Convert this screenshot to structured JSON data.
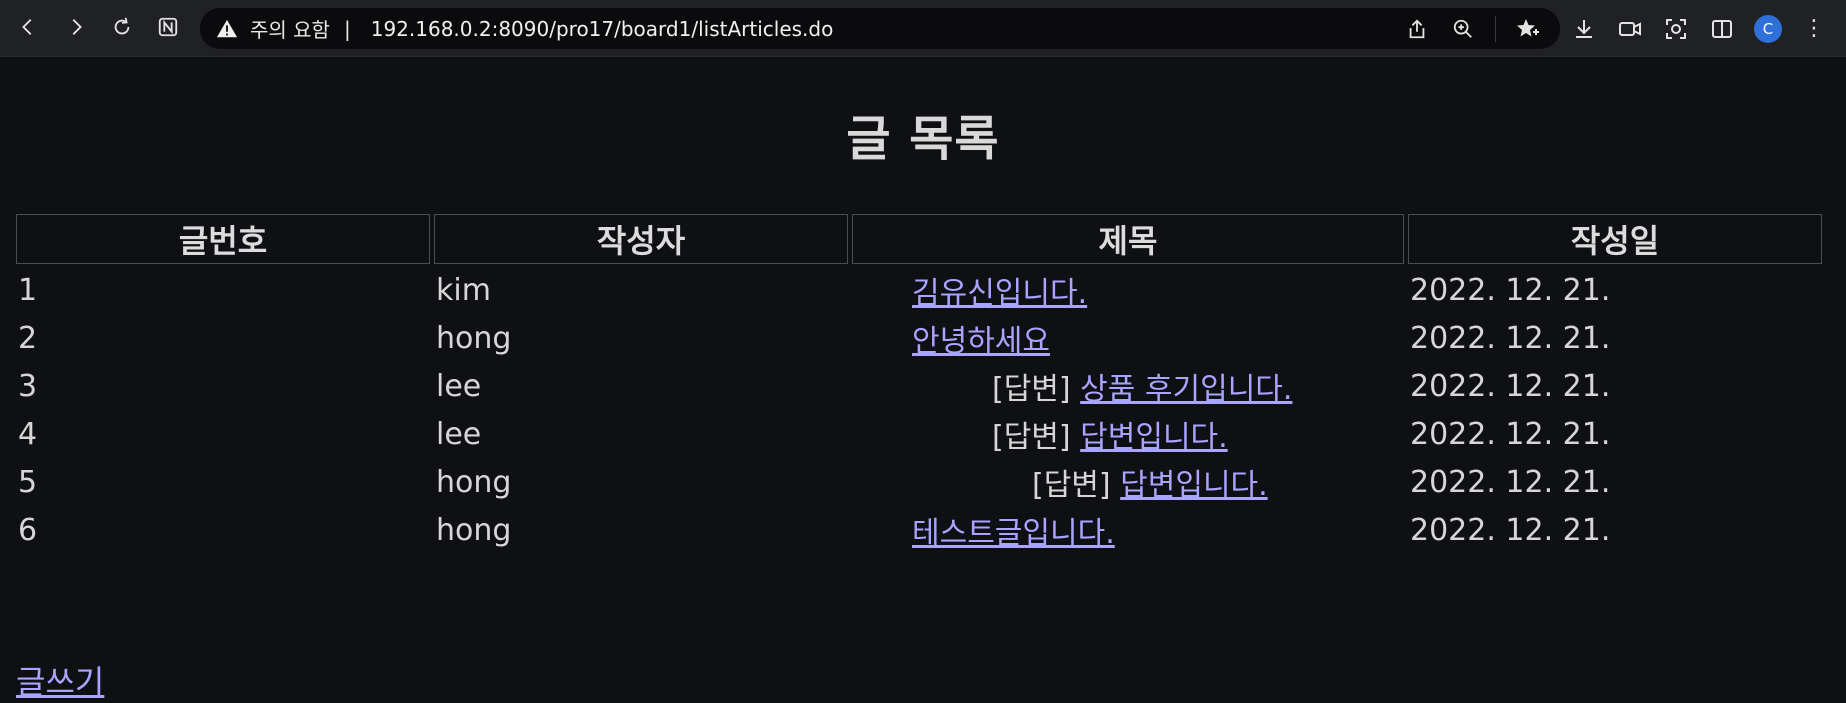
{
  "browser": {
    "security_warning": "주의 요함",
    "separator": "|",
    "url": "192.168.0.2:8090/pro17/board1/listArticles.do",
    "avatar_letter": "C",
    "accent": "#2f6fd8"
  },
  "page": {
    "title": "글 목록",
    "columns": [
      "글번호",
      "작성자",
      "제목",
      "작성일"
    ],
    "rows": [
      {
        "num": "1",
        "author": "kim",
        "reply": "",
        "title": "김유신입니다.",
        "date": "2022. 12. 21."
      },
      {
        "num": "2",
        "author": "hong",
        "reply": "",
        "title": "안녕하세요",
        "date": "2022. 12. 21."
      },
      {
        "num": "3",
        "author": "lee",
        "reply": "[답변]",
        "title": "상품 후기입니다.",
        "date": "2022. 12. 21."
      },
      {
        "num": "4",
        "author": "lee",
        "reply": "[답변]",
        "title": "답변입니다.",
        "date": "2022. 12. 21."
      },
      {
        "num": "5",
        "author": "hong",
        "reply": "[답변]",
        "title": "답변입니다.",
        "date": "2022. 12. 21."
      },
      {
        "num": "6",
        "author": "hong",
        "reply": "",
        "title": "테스트글입니다.",
        "date": "2022. 12. 21."
      }
    ],
    "write_link": "글쓰기",
    "link_color": "#a8a4ff"
  }
}
